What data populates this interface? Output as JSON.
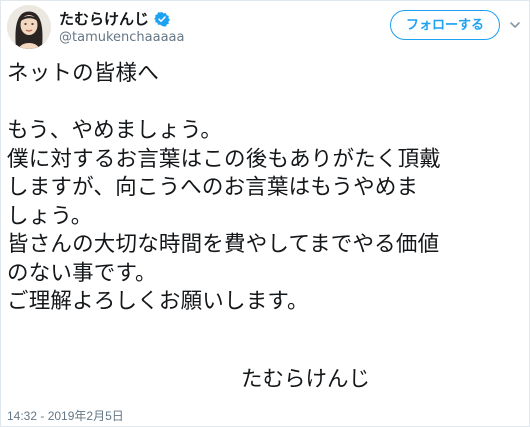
{
  "profile": {
    "display_name": "たむらけんじ",
    "handle": "@tamukenchaaaaa",
    "avatar_icon": "avatar-portrait",
    "verified_icon": "verified-badge-icon",
    "verified_color": "#1da1f2"
  },
  "actions": {
    "follow_label": "フォローする",
    "menu_icon": "chevron-down-icon"
  },
  "tweet": {
    "lines": [
      "ネットの皆様へ",
      "",
      "もう、やめましょう。",
      "僕に対するお言葉はこの後もありがたく頂戴",
      "しますが、向こうへのお言葉はもうやめま",
      "しょう。",
      "皆さんの大切な時間を費やしてまでやる価値",
      "のない事です。",
      "ご理解よろしくお願いします。"
    ],
    "signature": "たむらけんじ",
    "timestamp": "14:32 - 2019年2月5日"
  },
  "colors": {
    "accent": "#1da1f2",
    "text": "#14171a",
    "muted": "#657786",
    "border": "#e1e8ed"
  }
}
